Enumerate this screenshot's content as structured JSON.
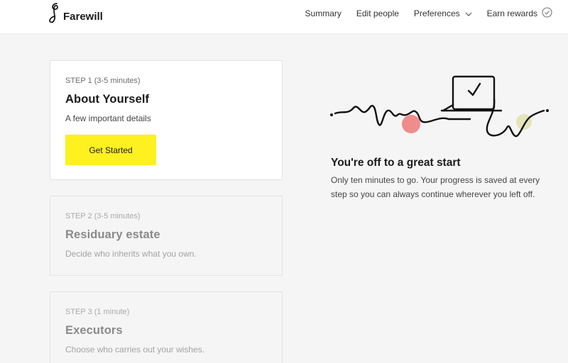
{
  "brand": {
    "name": "Farewill"
  },
  "nav": {
    "items": [
      {
        "label": "Summary"
      },
      {
        "label": "Edit people"
      },
      {
        "label": "Preferences"
      },
      {
        "label": "Earn rewards"
      }
    ]
  },
  "steps": [
    {
      "label": "STEP 1 (3-5 minutes)",
      "title": "About Yourself",
      "description": "A few important details",
      "button": "Get Started",
      "active": true
    },
    {
      "label": "STEP 2 (3-5 minutes)",
      "title": "Residuary estate",
      "description": "Decide who inherits what you own.",
      "active": false
    },
    {
      "label": "STEP 3 (1 minute)",
      "title": "Executors",
      "description": "Choose who carries out your wishes.",
      "active": false
    }
  ],
  "promo": {
    "title": "You're off to a great start",
    "text": "Only ten minutes to go. Your progress is saved at every step so you can always continue wherever you left off."
  },
  "icons": {
    "logo": "farewill-logo-icon",
    "preferences_dropdown": "chevron-down-icon",
    "rewards_status": "check-circle-icon"
  },
  "colors": {
    "accent_button": "#fff01f",
    "illustration_pink": "#f08c8c",
    "illustration_olive": "#e6e4b8"
  }
}
